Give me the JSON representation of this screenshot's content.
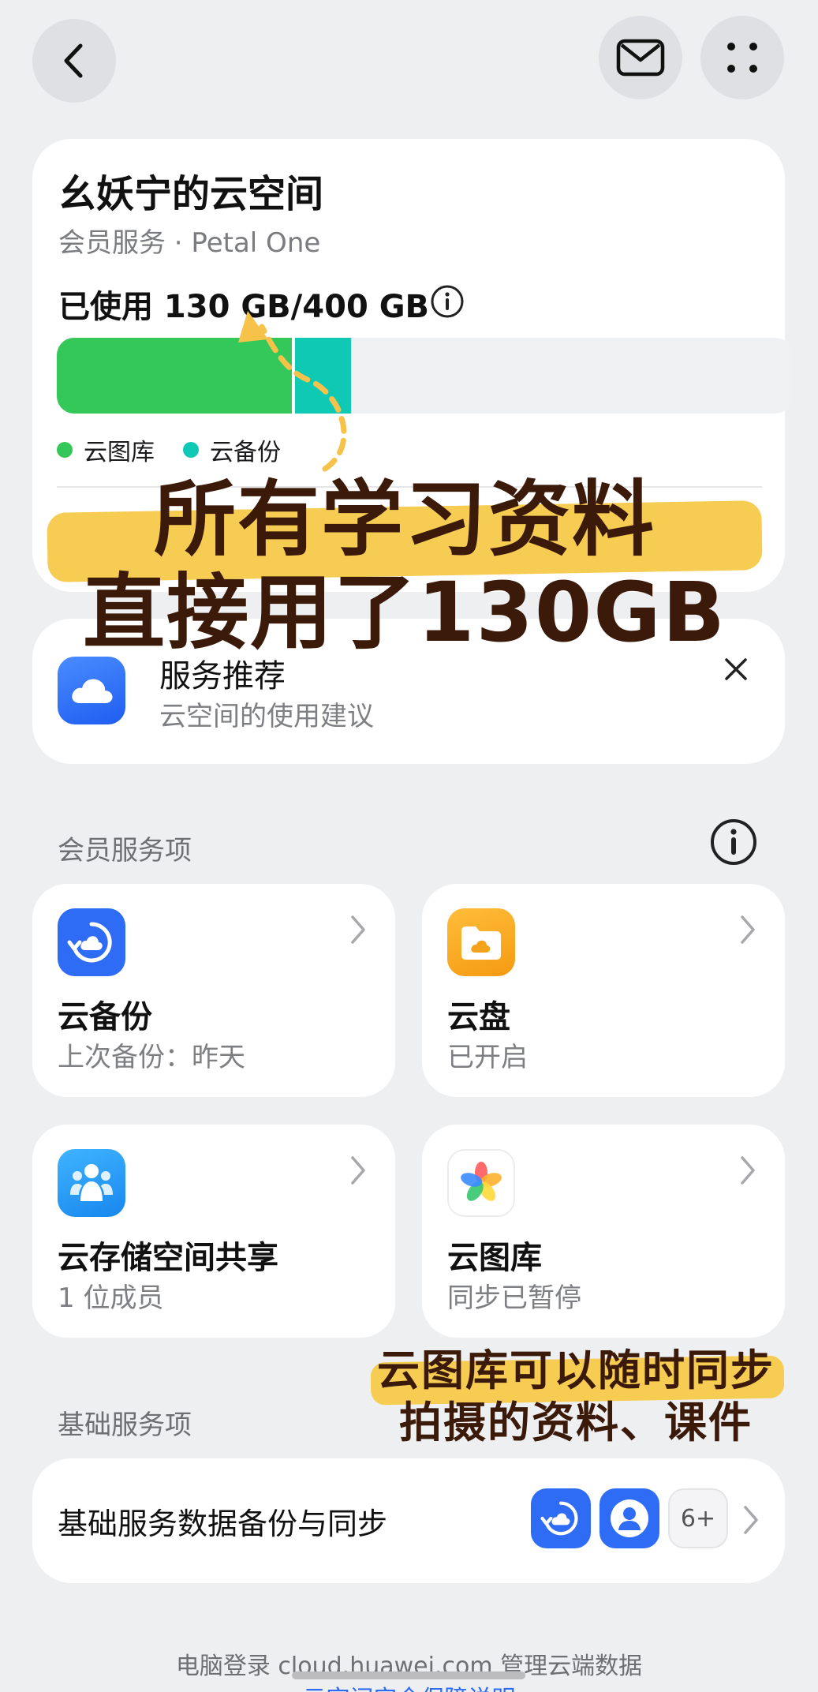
{
  "top_bar": {
    "back_icon": "chevron-left-icon",
    "mail_icon": "mail-icon",
    "more_icon": "grid-dots-icon"
  },
  "storage_card": {
    "title": "幺妖宁的云空间",
    "subtitle": "会员服务 · Petal One",
    "usage_text": "已使用 130 GB/400 GB",
    "info_icon": "info-icon",
    "usage_total_gb": 400,
    "usage_used_gb": 130,
    "segments": [
      {
        "name": "云图库",
        "color": "#34c759",
        "fraction": 0.32
      },
      {
        "name": "云备份",
        "color": "#10c9b4",
        "fraction": 0.08
      }
    ],
    "legend": [
      "云图库",
      "云备份"
    ]
  },
  "recommend_card": {
    "title": "服务推荐",
    "subtitle": "云空间的使用建议",
    "icon": "cloud-icon",
    "close_icon": "close-icon"
  },
  "member_section": {
    "heading": "会员服务项",
    "info_icon": "info-icon",
    "tiles": [
      {
        "title": "云备份",
        "status": "上次备份：昨天",
        "icon": "cloud-backup-icon",
        "color": "#2f6cf5"
      },
      {
        "title": "云盘",
        "status": "已开启",
        "icon": "cloud-drive-icon",
        "color": "#f7a21b"
      },
      {
        "title": "云存储空间共享",
        "status": "1 位成员",
        "icon": "family-share-icon",
        "color": "#1e9df2"
      },
      {
        "title": "云图库",
        "status": "同步已暂停",
        "icon": "gallery-icon",
        "color": "#ffffff"
      }
    ]
  },
  "basic_section": {
    "heading": "基础服务项",
    "row_title": "基础服务数据备份与同步",
    "more_badge": "6+"
  },
  "footer": {
    "text": "电脑登录 cloud.huawei.com 管理云端数据",
    "link": "云空间安全保障说明"
  },
  "overlay": {
    "headline_line1": "所有学习资料",
    "headline_line2": "直接用了130GB",
    "caption_line1": "云图库可以随时同步",
    "caption_line2": "拍摄的资料、课件"
  }
}
